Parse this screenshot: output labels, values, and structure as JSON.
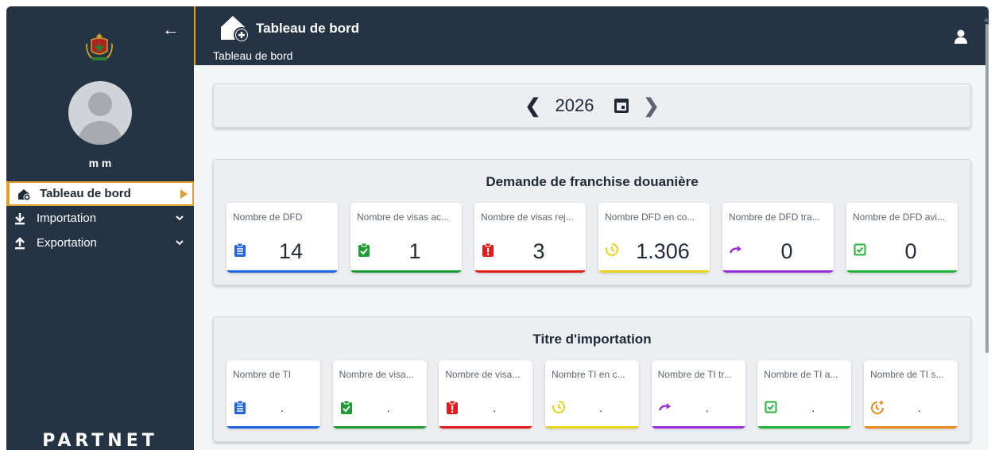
{
  "sidebar": {
    "username": "m m",
    "brand": "PARTNET",
    "items": [
      {
        "label": "Tableau de bord",
        "icon": "home-plus-icon",
        "active": true
      },
      {
        "label": "Importation",
        "icon": "download-icon",
        "active": false
      },
      {
        "label": "Exportation",
        "icon": "upload-icon",
        "active": false
      }
    ]
  },
  "header": {
    "title": "Tableau de bord",
    "breadcrumb": "Tableau de bord"
  },
  "year_selector": {
    "year": "2026"
  },
  "dfd_panel": {
    "title": "Demande de franchise douanière",
    "cards": [
      {
        "label": "Nombre de DFD",
        "value": "14",
        "icon": "clipboard-list-icon",
        "color": "#1e63e0"
      },
      {
        "label": "Nombre de visas ac...",
        "value": "1",
        "icon": "clipboard-check-icon",
        "color": "#1e9b32"
      },
      {
        "label": "Nombre de visas rej...",
        "value": "3",
        "icon": "clipboard-alert-icon",
        "color": "#e01b1b"
      },
      {
        "label": "Nombre DFD en co...",
        "value": "1.306",
        "icon": "clock-progress-icon",
        "color": "#e8d418"
      },
      {
        "label": "Nombre de DFD tra...",
        "value": "0",
        "icon": "redo-arrow-icon",
        "color": "#9b2fd6"
      },
      {
        "label": "Nombre de DFD avi...",
        "value": "0",
        "icon": "checkbox-icon",
        "color": "#25b23a"
      }
    ]
  },
  "ti_panel": {
    "title": "Titre d'importation",
    "cards": [
      {
        "label": "Nombre de TI",
        "value": ".",
        "icon": "clipboard-list-icon",
        "color": "#1e63e0"
      },
      {
        "label": "Nombre de visa...",
        "value": ".",
        "icon": "clipboard-check-icon",
        "color": "#1e9b32"
      },
      {
        "label": "Nombre de visa...",
        "value": ".",
        "icon": "clipboard-alert-icon",
        "color": "#e01b1b"
      },
      {
        "label": "Nombre TI en c...",
        "value": ".",
        "icon": "clock-progress-icon",
        "color": "#e8d418"
      },
      {
        "label": "Nombre de TI tr...",
        "value": ".",
        "icon": "redo-arrow-icon",
        "color": "#9b2fd6"
      },
      {
        "label": "Nombre de TI a...",
        "value": ".",
        "icon": "checkbox-icon",
        "color": "#25b23a"
      },
      {
        "label": "Nombre de TI s...",
        "value": ".",
        "icon": "clock-plus-icon",
        "color": "#e8891b"
      }
    ]
  }
}
